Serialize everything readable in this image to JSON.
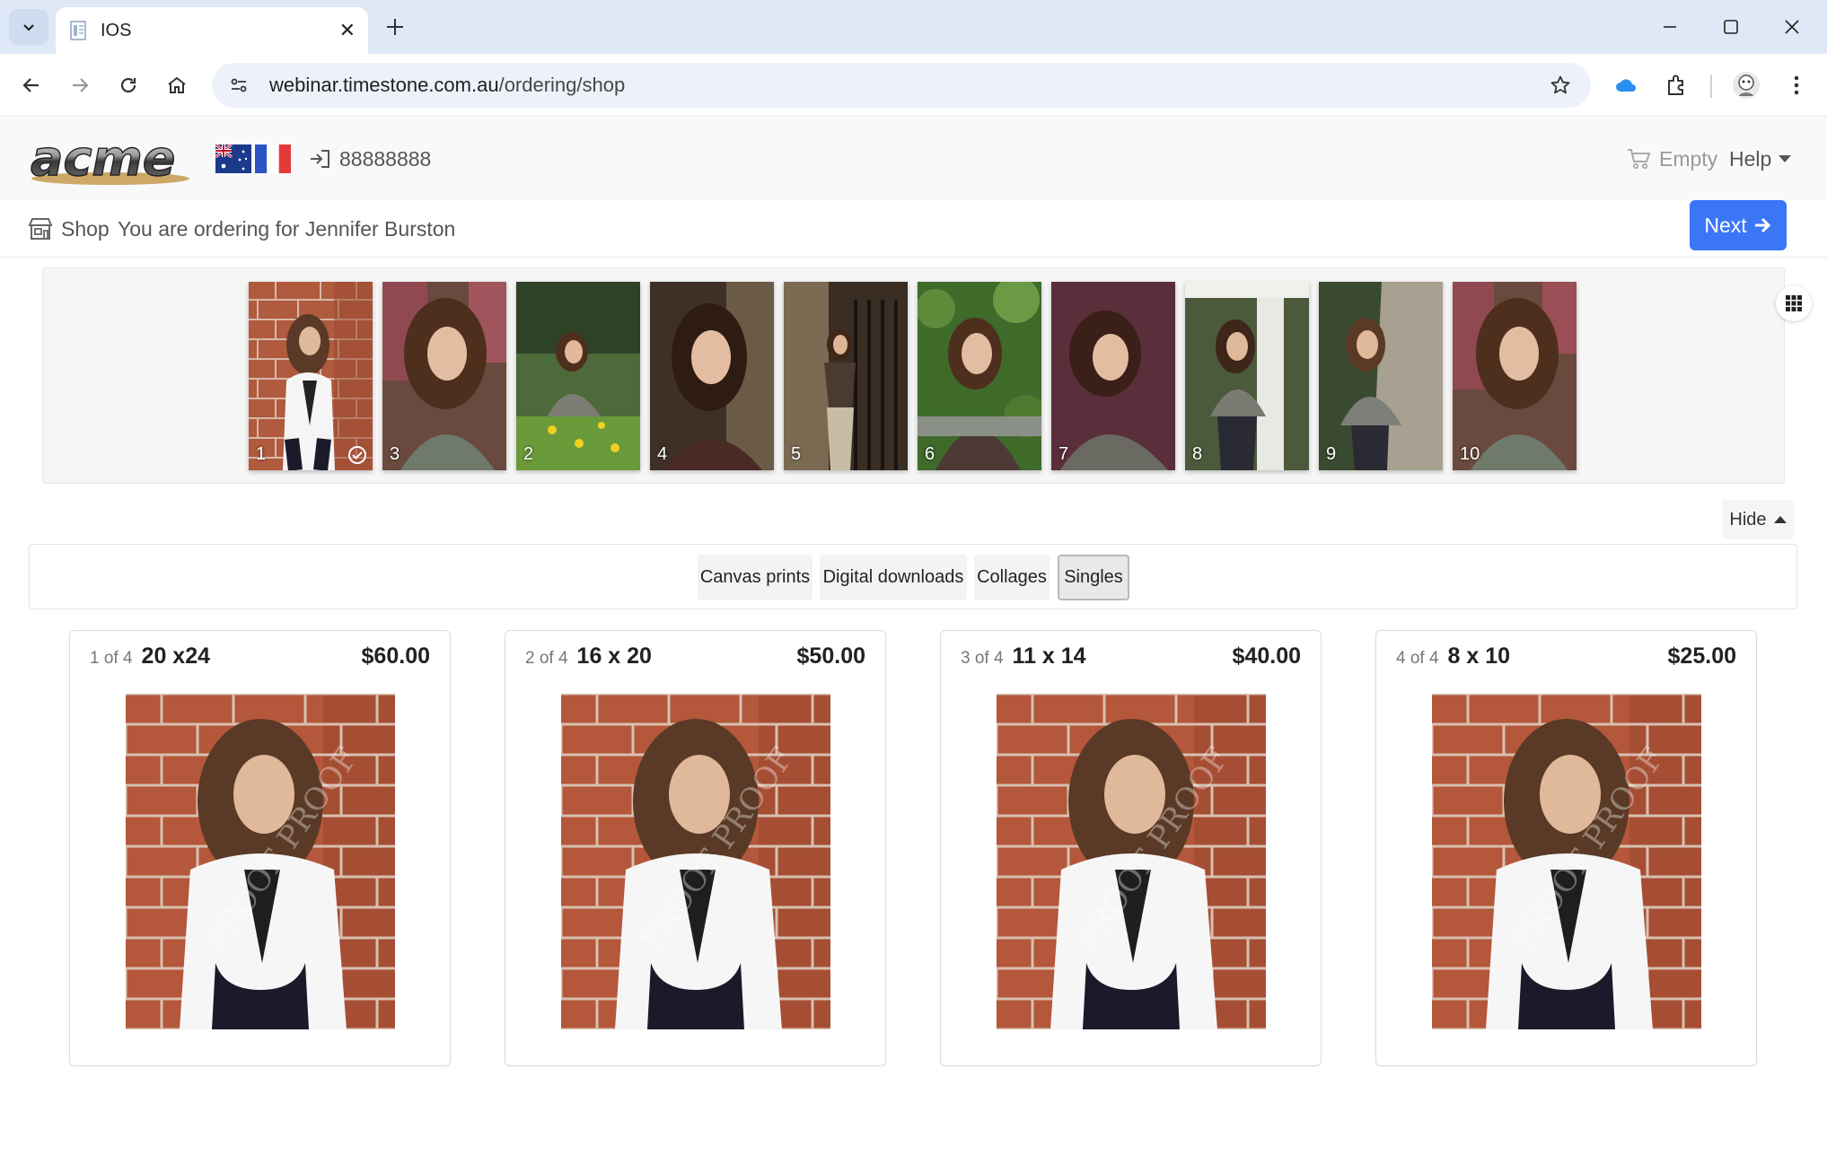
{
  "browser": {
    "tab_title": "IOS",
    "url_host": "webinar.timestone.com.au",
    "url_path": "/ordering/shop"
  },
  "header": {
    "logo_text": "acme",
    "phone": "88888888",
    "cart_label": "Empty",
    "help_label": "Help"
  },
  "crumb": {
    "shop_label": "Shop",
    "ordering_for": "You are ordering for Jennifer Burston",
    "next_label": "Next"
  },
  "filmstrip": {
    "thumbnails": [
      {
        "number": "1",
        "selected": true
      },
      {
        "number": "3"
      },
      {
        "number": "2"
      },
      {
        "number": "4"
      },
      {
        "number": "5"
      },
      {
        "number": "6"
      },
      {
        "number": "7"
      },
      {
        "number": "8"
      },
      {
        "number": "9"
      },
      {
        "number": "10"
      }
    ],
    "hide_label": "Hide"
  },
  "categories": [
    {
      "label": "Canvas prints"
    },
    {
      "label": "Digital downloads"
    },
    {
      "label": "Collages"
    },
    {
      "label": "Singles",
      "active": true
    }
  ],
  "products": [
    {
      "index": "1 of 4",
      "size": "20 x24",
      "price": "$60.00"
    },
    {
      "index": "2 of 4",
      "size": "16 x 20",
      "price": "$50.00"
    },
    {
      "index": "3 of 4",
      "size": "11 x 14",
      "price": "$40.00"
    },
    {
      "index": "4 of 4",
      "size": "8 x 10",
      "price": "$25.00"
    }
  ],
  "colors": {
    "accent": "#3b76f6",
    "tabbar": "#dfe8f6",
    "header_bg": "#f8f9fa"
  }
}
